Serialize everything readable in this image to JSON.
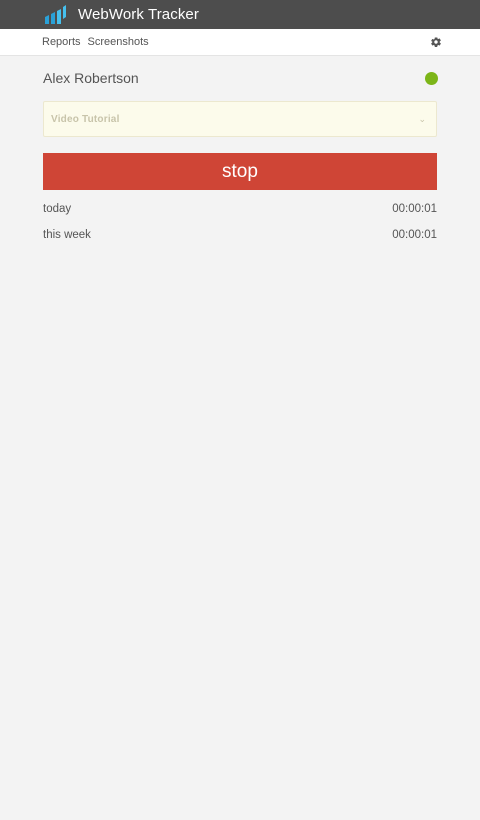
{
  "app": {
    "title": "WebWork Tracker",
    "icon": "webwork-logo"
  },
  "nav": {
    "links": [
      "Reports",
      "Screenshots"
    ],
    "settings_icon": "gear-icon"
  },
  "user": {
    "name": "Alex Robertson",
    "status_color": "#7cb518",
    "status": "online"
  },
  "project": {
    "selected": "Video Tutorial"
  },
  "timer": {
    "button_label": "stop",
    "button_color": "#cf4536"
  },
  "stats": [
    {
      "label": "today",
      "value": "00:00:01"
    },
    {
      "label": "this week",
      "value": "00:00:01"
    }
  ]
}
